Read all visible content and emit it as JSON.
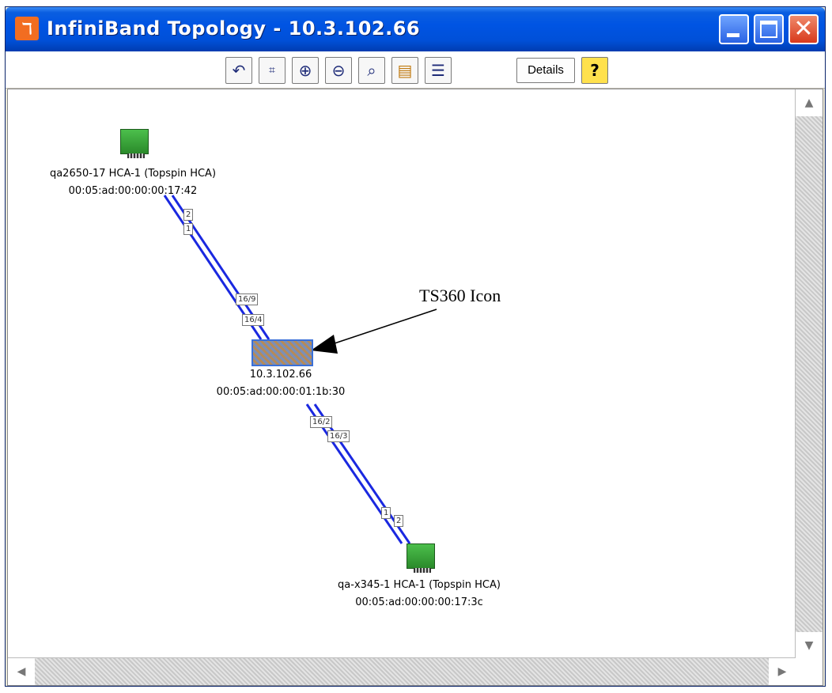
{
  "window": {
    "title": "InfiniBand Topology - 10.3.102.66"
  },
  "toolbar": {
    "details_label": "Details",
    "buttons": [
      "back-icon",
      "fit-icon",
      "zoom-in-icon",
      "zoom-out-icon",
      "zoom-fit-icon",
      "layout-icon",
      "list-icon",
      "help-icon"
    ]
  },
  "nodes": {
    "hca_top": {
      "name": "qa2650-17 HCA-1 (Topspin HCA)",
      "guid": "00:05:ad:00:00:00:17:42"
    },
    "switch": {
      "name": "10.3.102.66",
      "guid": "00:05:ad:00:00:01:1b:30"
    },
    "hca_bottom": {
      "name": "qa-x345-1 HCA-1 (Topspin HCA)",
      "guid": "00:05:ad:00:00:00:17:3c"
    }
  },
  "ports": {
    "top_a": "2",
    "top_b": "1",
    "sw_up_a": "16/9",
    "sw_up_b": "16/4",
    "sw_down_a": "16/2",
    "sw_down_b": "16/3",
    "bottom_a": "1",
    "bottom_b": "2"
  },
  "annotation": {
    "text": "TS360 Icon"
  },
  "colors": {
    "link": "#1a28e0",
    "hca": "#3a9a3a",
    "title_bar": "#0054e3"
  }
}
